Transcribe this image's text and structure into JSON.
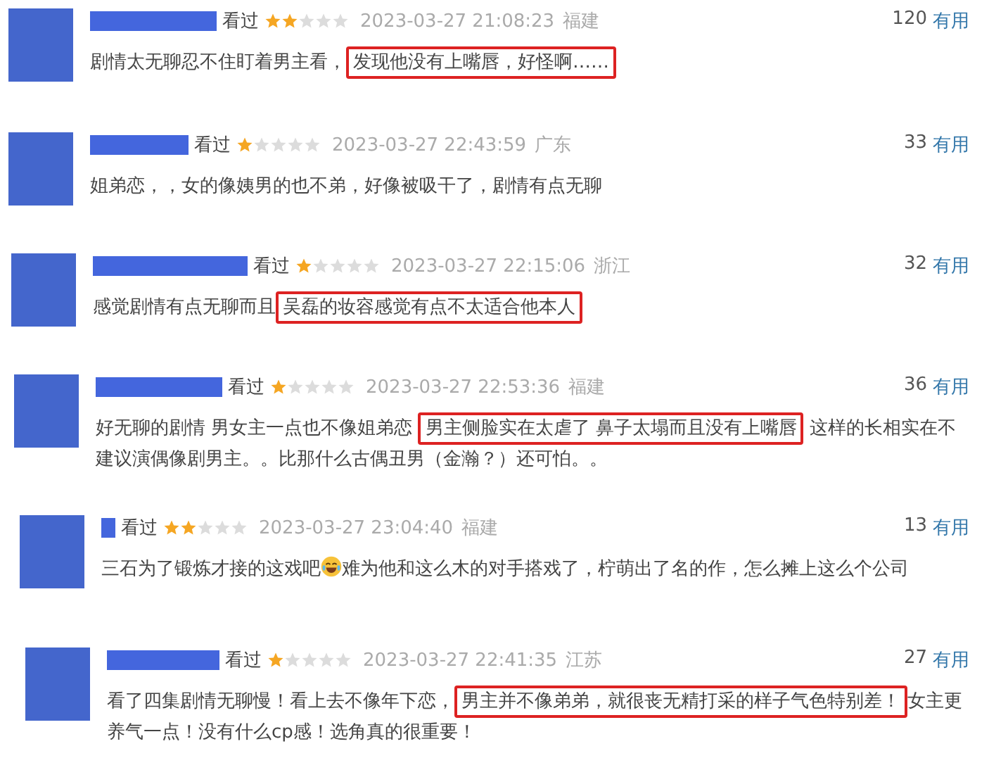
{
  "comments": [
    {
      "watched": "看过",
      "stars": 2,
      "time": "2023-03-27 21:08:23",
      "region": "福建",
      "votes": "120",
      "useful": "有用",
      "content": [
        {
          "kind": "text",
          "text": "剧情太无聊忍不住盯着男主看，"
        },
        {
          "kind": "highlight",
          "text": "发现他没有上嘴唇，好怪啊……"
        }
      ]
    },
    {
      "watched": "看过",
      "stars": 1,
      "time": "2023-03-27 22:43:59",
      "region": "广东",
      "votes": "33",
      "useful": "有用",
      "content": [
        {
          "kind": "text",
          "text": "姐弟恋，，女的像姨男的也不弟，好像被吸干了，剧情有点无聊"
        }
      ]
    },
    {
      "watched": "看过",
      "stars": 1,
      "time": "2023-03-27 22:15:06",
      "region": "浙江",
      "votes": "32",
      "useful": "有用",
      "content": [
        {
          "kind": "text",
          "text": "感觉剧情有点无聊而且"
        },
        {
          "kind": "highlight",
          "text": "吴磊的妆容感觉有点不太适合他本人"
        }
      ]
    },
    {
      "watched": "看过",
      "stars": 1,
      "time": "2023-03-27 22:53:36",
      "region": "福建",
      "votes": "36",
      "useful": "有用",
      "content": [
        {
          "kind": "text",
          "text": "好无聊的剧情 男女主一点也不像姐弟恋 "
        },
        {
          "kind": "highlight",
          "text": "男主侧脸实在太虐了 鼻子太塌而且没有上嘴唇"
        },
        {
          "kind": "text",
          "text": " 这样的长相实在不建议演偶像剧男主。。比那什么古偶丑男（金瀚？）还可怕。。"
        }
      ]
    },
    {
      "watched": "看过",
      "stars": 2,
      "time": "2023-03-27 23:04:40",
      "region": "福建",
      "votes": "13",
      "useful": "有用",
      "content": [
        {
          "kind": "text",
          "text": "三石为了锻炼才接的这戏吧"
        },
        {
          "kind": "emoji"
        },
        {
          "kind": "text",
          "text": "难为他和这么木的对手搭戏了，柠萌出了名的作，怎么摊上这么个公司"
        }
      ]
    },
    {
      "watched": "看过",
      "stars": 1,
      "time": "2023-03-27 22:41:35",
      "region": "江苏",
      "votes": "27",
      "useful": "有用",
      "content": [
        {
          "kind": "text",
          "text": "看了四集剧情无聊慢！看上去不像年下恋，"
        },
        {
          "kind": "highlight",
          "text": "男主并不像弟弟，就很丧无精打采的样子气色特别差！"
        },
        {
          "kind": "text",
          "text": "女主更养气一点！没有什么cp感！选角真的很重要！"
        }
      ]
    }
  ]
}
